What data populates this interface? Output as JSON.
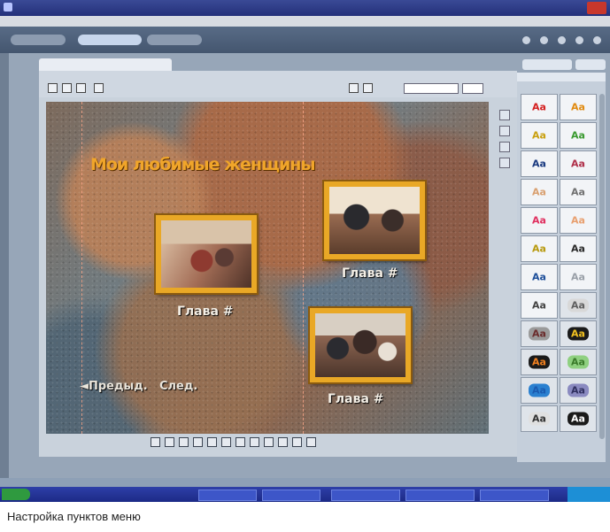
{
  "canvas_menu": {
    "title": "Мои любимые женщины",
    "chapters": [
      {
        "label": "Глава #"
      },
      {
        "label": "Глава #"
      },
      {
        "label": "Глава #"
      }
    ],
    "nav": {
      "prev_label": "◄Предыд.",
      "next_label": "След."
    }
  },
  "palette": {
    "swatches": [
      {
        "text": "Aa",
        "color": "#d42020",
        "bg": "#f6f6f6"
      },
      {
        "text": "Aa",
        "color": "#e08a10",
        "bg": "#f6f6f6"
      },
      {
        "text": "Aa",
        "color": "#c9a010",
        "bg": "#f6f6f6"
      },
      {
        "text": "Aa",
        "color": "#3a9a30",
        "bg": "#f6f6f6"
      },
      {
        "text": "Aa",
        "color": "#1a3a80",
        "bg": "#f6f6f6"
      },
      {
        "text": "Aa",
        "color": "#b0304a",
        "bg": "#f6f6f6"
      },
      {
        "text": "Aa",
        "color": "#d9a070",
        "bg": "#f6f6f6"
      },
      {
        "text": "Aa",
        "color": "#707070",
        "bg": "#f6f6f6"
      },
      {
        "text": "Aa",
        "color": "#e03060",
        "bg": "#f6f6f6"
      },
      {
        "text": "Aa",
        "color": "#e8a070",
        "bg": "#f6f6f6"
      },
      {
        "text": "Aa",
        "color": "#b89a10",
        "bg": "#f6f6f6"
      },
      {
        "text": "Aa",
        "color": "#2a2a2a",
        "bg": "#f6f6f6"
      },
      {
        "text": "Aa",
        "color": "#1e4f9a",
        "bg": "#f6f6f6"
      },
      {
        "text": "Aa",
        "color": "#9aa0a8",
        "bg": "#f6f6f6"
      },
      {
        "text": "Aa",
        "color": "#444444",
        "bg": "#f6f6f6"
      },
      {
        "text": "Aa",
        "color": "#606060",
        "bg": "#d8d8d8"
      },
      {
        "text": "Aa",
        "color": "#6a2c2c",
        "bg": "#9a9a9a"
      },
      {
        "text": "Aa",
        "color": "#f0c020",
        "bg": "#1a1a1a"
      },
      {
        "text": "Aa",
        "color": "#f08020",
        "bg": "#1a1a1a"
      },
      {
        "text": "Aa",
        "color": "#3a7a2a",
        "bg": "#8fd080"
      },
      {
        "text": "Aa",
        "color": "#1a5ab0",
        "bg": "#2a80d0"
      },
      {
        "text": "Aa",
        "color": "#303060",
        "bg": "#8a8ac0"
      },
      {
        "text": "Aa",
        "color": "#333333",
        "bg": "#e0e0e0"
      },
      {
        "text": "Aa",
        "color": "#ffffff",
        "bg": "#1a1a1a"
      }
    ]
  },
  "caption": "Настройка пунктов меню"
}
